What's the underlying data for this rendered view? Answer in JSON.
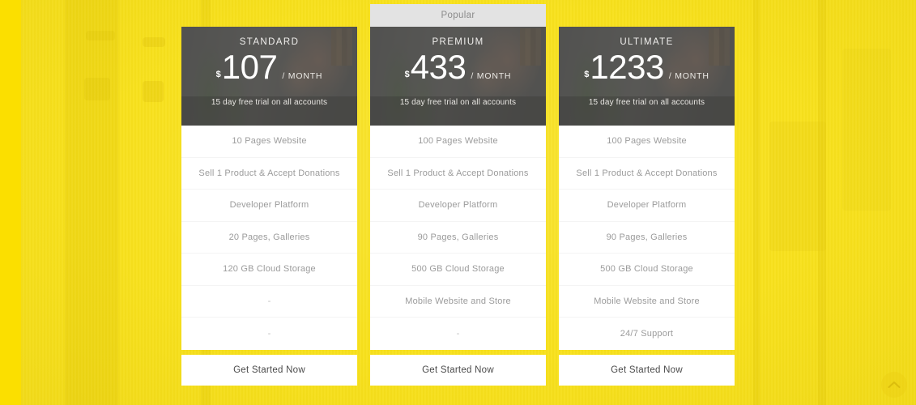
{
  "theme": {
    "background_color": "#f8e11c",
    "card_background": "#ffffff",
    "header_overlay": "#464644",
    "ribbon_background": "#e3e3e3",
    "feature_text_color": "#9b9b9b",
    "cta_text_color": "#4a4a4a"
  },
  "plans": [
    {
      "name": "STANDARD",
      "currency": "$",
      "amount": "107",
      "period": "/ MONTH",
      "trial": "15 day free trial on all accounts",
      "ribbon": null,
      "features": [
        "10 Pages Website",
        "Sell 1 Product & Accept Donations",
        "Developer Platform",
        "20 Pages, Galleries",
        "120 GB Cloud Storage",
        "-",
        "-"
      ],
      "cta": "Get Started Now"
    },
    {
      "name": "PREMIUM",
      "currency": "$",
      "amount": "433",
      "period": "/ MONTH",
      "trial": "15 day free trial on all accounts",
      "ribbon": "Popular",
      "features": [
        "100 Pages Website",
        "Sell 1 Product & Accept Donations",
        "Developer Platform",
        "90 Pages, Galleries",
        "500 GB Cloud Storage",
        "Mobile Website and Store",
        "-"
      ],
      "cta": "Get Started Now"
    },
    {
      "name": "ULTIMATE",
      "currency": "$",
      "amount": "1233",
      "period": "/ MONTH",
      "trial": "15 day free trial on all accounts",
      "ribbon": null,
      "features": [
        "100 Pages Website",
        "Sell 1 Product & Accept Donations",
        "Developer Platform",
        "90 Pages, Galleries",
        "500 GB Cloud Storage",
        "Mobile Website and Store",
        "24/7 Support"
      ],
      "cta": "Get Started Now"
    }
  ],
  "scroll_top": {
    "icon": "chevron-up-icon"
  }
}
